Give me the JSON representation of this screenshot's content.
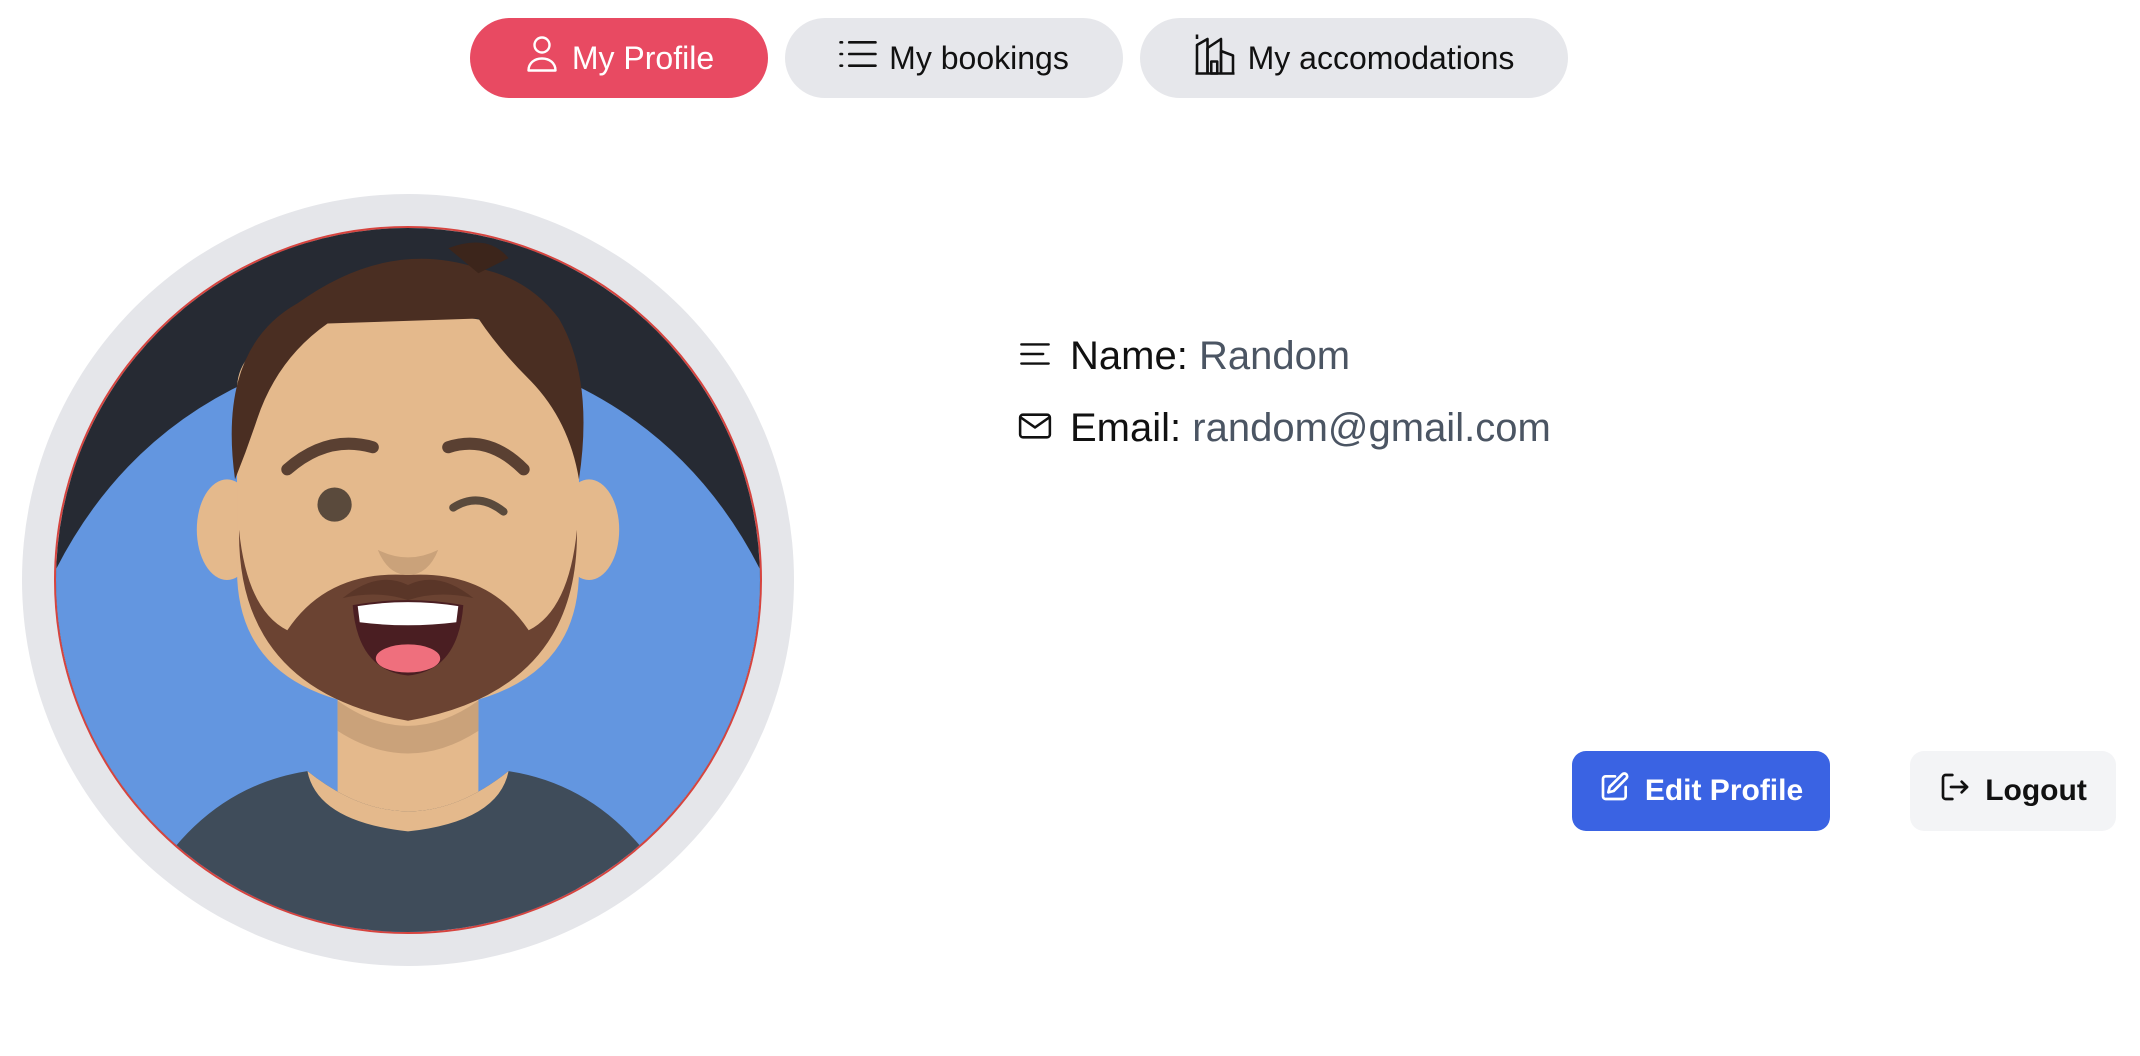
{
  "tabs": [
    {
      "label": "My Profile",
      "icon": "user-icon",
      "active": true
    },
    {
      "label": "My bookings",
      "icon": "list-icon",
      "active": false
    },
    {
      "label": "My accomodations",
      "icon": "building-icon",
      "active": false
    }
  ],
  "profile": {
    "name_label": "Name:",
    "name_value": "Random",
    "email_label": "Email:",
    "email_value": "random@gmail.com"
  },
  "actions": {
    "edit_label": "Edit Profile",
    "logout_label": "Logout"
  },
  "colors": {
    "accent": "#e84a62",
    "primary": "#3a63e3"
  }
}
